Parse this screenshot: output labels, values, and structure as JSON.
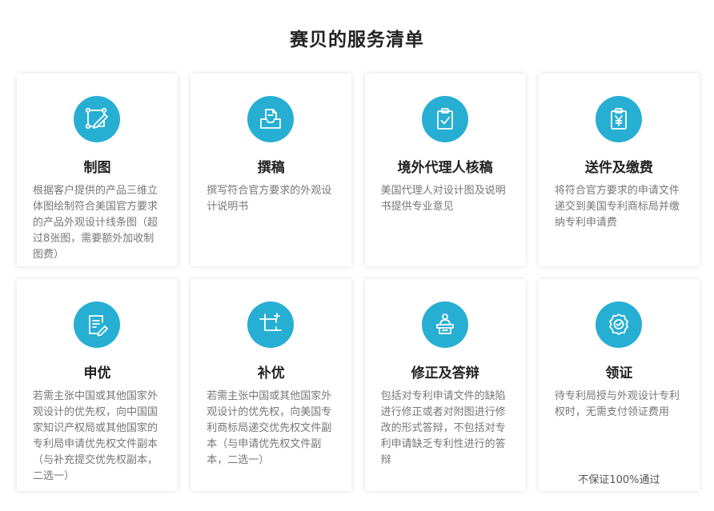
{
  "title": "赛贝的服务清单",
  "colors": {
    "accent": "#27aed3",
    "title": "#222222",
    "description": "#777777"
  },
  "cards": [
    {
      "icon": "drawing-icon",
      "title": "制图",
      "description": "根据客户提供的产品三维立体图绘制符合美国官方要求的产品外观设计线条图（超过8张图，需要额外加收制图费）"
    },
    {
      "icon": "document-tray-icon",
      "title": "撰稿",
      "description": "撰写符合官方要求的外观设计说明书"
    },
    {
      "icon": "clipboard-check-icon",
      "title": "境外代理人核稿",
      "description": "美国代理人对设计图及说明书提供专业意见"
    },
    {
      "icon": "yen-receipt-icon",
      "title": "送件及缴费",
      "description": "将符合官方要求的申请文件递交到美国专利商标局并缴纳专利申请费"
    },
    {
      "icon": "document-edit-icon",
      "title": "申优",
      "description": "若需主张中国或其他国家外观设计的优先权，向中国国家知识产权局或其他国家的专利局申请优先权文件副本（与补充提交优先权副本，二选一）"
    },
    {
      "icon": "crop-add-icon",
      "title": "补优",
      "description": "若需主张中国或其他国家外观设计的优先权，向美国专利商标局递交优先权文件副本（与申请优先权文件副本，二选一）"
    },
    {
      "icon": "speaker-podium-icon",
      "title": "修正及答辩",
      "description": "包括对专利申请文件的缺陷进行修正或者对附图进行修改的形式答辩，不包括对专利申请缺乏专利性进行的答辩"
    },
    {
      "icon": "certificate-badge-icon",
      "title": "领证",
      "description": "待专利局授与外观设计专利权时，无需支付领证费用",
      "note": "不保证100%通过"
    }
  ]
}
